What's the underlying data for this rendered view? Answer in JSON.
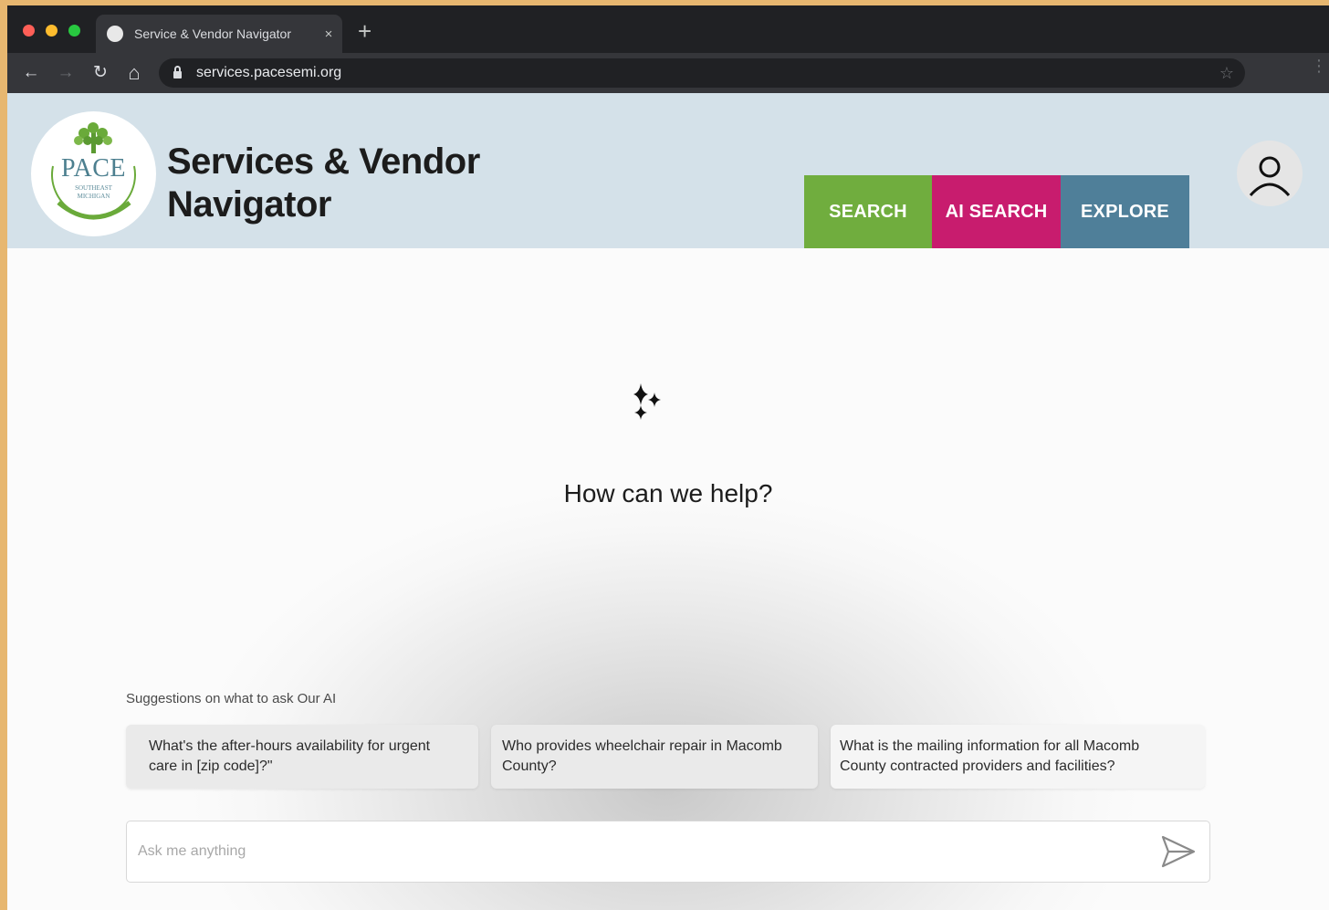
{
  "browser": {
    "tab_title": "Service & Vendor Navigator",
    "tab_close": "×",
    "new_tab": "+",
    "url": "services.pacesemi.org",
    "back": "←",
    "forward": "→",
    "reload": "↻",
    "home": "⌂",
    "bookmark": "☆",
    "menu": "⋮"
  },
  "header": {
    "logo_text": "PACE",
    "logo_subtext_1": "SOUTHEAST",
    "logo_subtext_2": "MICHIGAN",
    "title_line1": "Services & Vendor",
    "title_line2": "Navigator",
    "nav": [
      {
        "label": "SEARCH",
        "color": "#70ad3e"
      },
      {
        "label": "AI SEARCH",
        "color": "#c81c6e"
      },
      {
        "label": "EXPLORE",
        "color": "#4f7f99"
      }
    ],
    "avatar_icon": "user-icon"
  },
  "main": {
    "sparkle_icon": "sparkle-icon",
    "heading": "How can we help?",
    "suggestions_label": "Suggestions on what to ask Our AI",
    "suggestions": [
      "What's the after-hours availability for urgent care in [zip code]?\"",
      "Who provides wheelchair repair in Macomb County?",
      "What is the mailing information for all Macomb County contracted providers and facilities?"
    ],
    "input_placeholder": "Ask me anything",
    "input_value": "",
    "send_icon": "send-icon"
  }
}
